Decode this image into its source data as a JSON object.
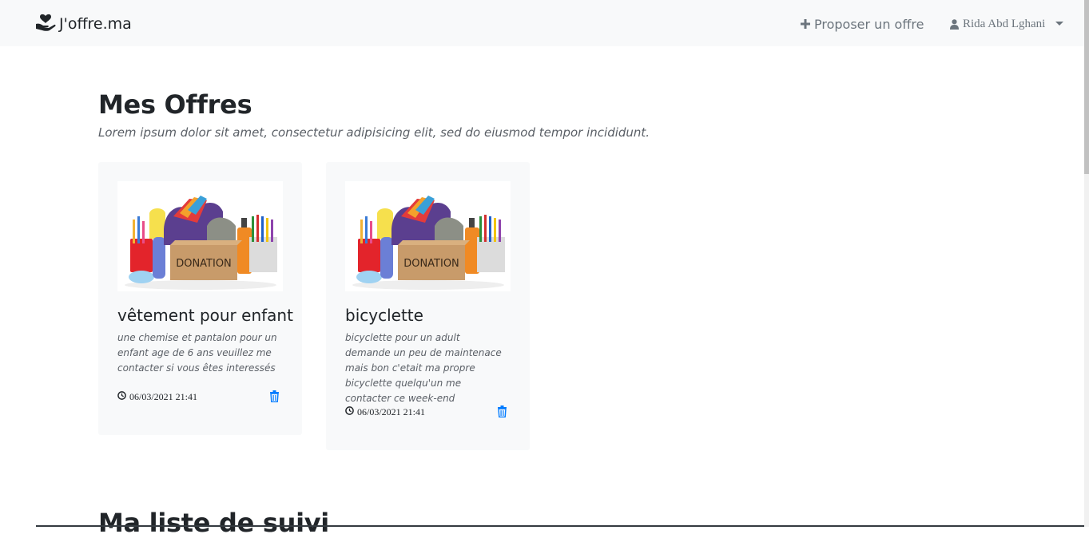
{
  "navbar": {
    "brand": "J'offre.ma",
    "brand_icon": "hand-heart-icon",
    "offer_link": "Proposer un offre",
    "offer_icon": "plus-icon",
    "user_name": "Rida Abd Lghani",
    "user_icon": "user-icon"
  },
  "my_offers": {
    "title": "Mes Offres",
    "subtitle": "Lorem ipsum dolor sit amet, consectetur adipisicing elit, sed do eiusmod tempor incididunt.",
    "cards": [
      {
        "title": "vêtement pour enfant",
        "description": "une chemise et pantalon pour un enfant age de 6 ans veuillez me contacter si vous êtes interessés",
        "date": "06/03/2021 21:41",
        "image_label": "DONATION"
      },
      {
        "title": "bicyclette",
        "description": "bicyclette pour un adult demande un peu de maintenace mais bon c'etait ma propre bicyclette quelqu'un me contacter ce week-end",
        "date": "06/03/2021 21:41",
        "image_label": "DONATION"
      }
    ]
  },
  "watchlist": {
    "title": "Ma liste de suivi"
  },
  "colors": {
    "navbar_bg": "#f8f9fa",
    "accent": "#007bff",
    "muted": "#6c757d"
  }
}
